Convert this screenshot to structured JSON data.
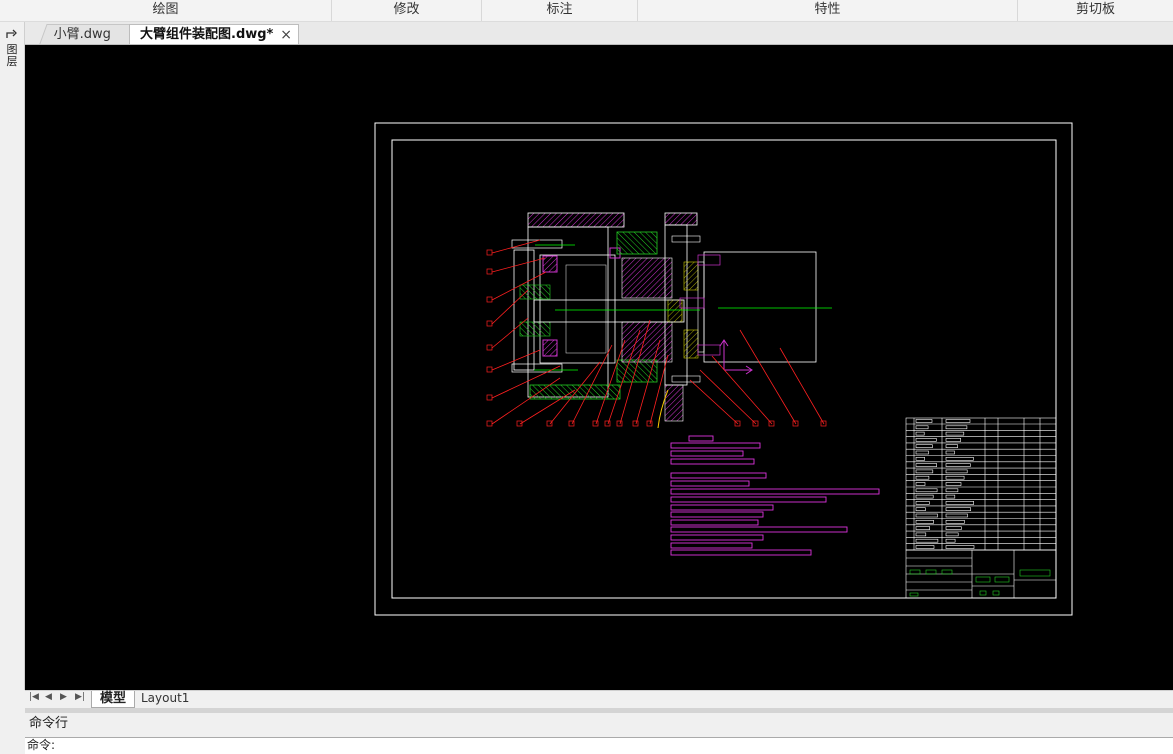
{
  "ribbon": {
    "panels": [
      {
        "label": "绘图"
      },
      {
        "label": "修改"
      },
      {
        "label": "标注"
      },
      {
        "label": "特性"
      },
      {
        "label": "剪切板"
      }
    ]
  },
  "left_strip": {
    "label": "图层"
  },
  "doc_tabs": [
    {
      "label": "小臂.dwg",
      "active": false
    },
    {
      "label": "大臂组件装配图.dwg*",
      "active": true
    }
  ],
  "layout_tabs": [
    {
      "label": "模型",
      "active": true
    },
    {
      "label": "Layout1",
      "active": false
    }
  ],
  "command": {
    "title": "命令行",
    "prompt": "命令:"
  },
  "colors": {
    "canvas_bg": "#000000",
    "frame": "#ffffff",
    "hatch_main": "#cc33cc",
    "hatch_green": "#22cc22",
    "leader_lines": "#ff2020",
    "centerline": "#00ff00",
    "yellow": "#ffff00",
    "parts_list": "#dd33dd"
  }
}
